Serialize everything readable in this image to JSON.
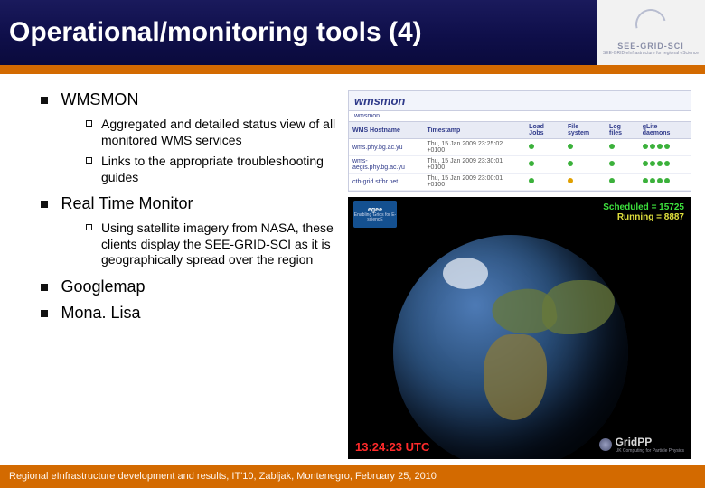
{
  "header": {
    "title": "Operational/monitoring tools (4)",
    "brand": "SEE-GRID-SCI",
    "brand_sub": "SEE-GRID eInfrastructure for regional eScience"
  },
  "bullets": {
    "b1": {
      "label": "WMSMON",
      "sub1": "Aggregated and detailed status view of all monitored WMS services",
      "sub2": "Links to the appropriate troubleshooting guides"
    },
    "b2": {
      "label": "Real Time Monitor",
      "sub1": "Using satellite imagery from NASA, these clients display the SEE-GRID-SCI as it is geographically spread over the region"
    },
    "b3": {
      "label": "Googlemap"
    },
    "b4": {
      "label": "Mona. Lisa"
    }
  },
  "wmsmon": {
    "logo": "wmsmon",
    "tab": "wmsmon",
    "cols": [
      "WMS Hostname",
      "Timestamp",
      "Load Jobs",
      "File system",
      "Log files",
      "gLite daemons"
    ],
    "rows": [
      {
        "host": "wms.phy.bg.ac.yu",
        "ts": "Thu, 15 Jan 2009 23:25:02 +0100"
      },
      {
        "host": "wms-aegis.phy.bg.ac.yu",
        "ts": "Thu, 15 Jan 2009 23:30:01 +0100"
      },
      {
        "host": "ctb-grid.stfbr.net",
        "ts": "Thu, 15 Jan 2009 23:00:01 +0100"
      }
    ]
  },
  "globe": {
    "egee": "egee",
    "egee_sub": "Enabling Grids for E-sciencE",
    "scheduled_label": "Scheduled = 15725",
    "running_label": "Running = 8887",
    "utc": "13:24:23 UTC",
    "gridpp": "GridPP",
    "gridpp_sub": "UK Computing for Particle Physics"
  },
  "footer": "Regional eInfrastructure development and results, IT'10, Zabljak, Montenegro, February 25, 2010"
}
